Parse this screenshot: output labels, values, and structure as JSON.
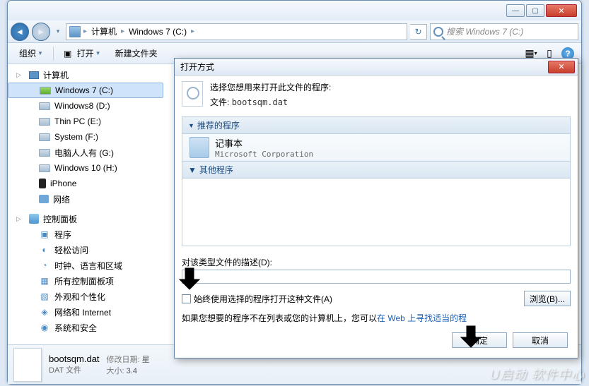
{
  "window": {
    "min_icon": "—",
    "max_icon": "▢",
    "close_icon": "✕"
  },
  "nav": {
    "back_icon": "◄",
    "fwd_icon": "►",
    "history_icon": "▾",
    "bc_root": "计算机",
    "bc_drive": "Windows 7  (C:)",
    "bc_sep": "▸",
    "refresh_icon": "↻",
    "search_placeholder": "搜索 Windows 7  (C:)"
  },
  "toolbar": {
    "organize": "组织",
    "open": "打开",
    "newfolder": "新建文件夹",
    "view_icon": "▦",
    "help_icon": "?"
  },
  "sidebar": {
    "computer": "计算机",
    "drives": [
      {
        "label": "Windows 7  (C:)",
        "selected": true,
        "cls": "win"
      },
      {
        "label": "Windows8 (D:)",
        "cls": ""
      },
      {
        "label": "Thin PC (E:)",
        "cls": ""
      },
      {
        "label": "System (F:)",
        "cls": ""
      },
      {
        "label": "电脑人人有  (G:)",
        "cls": ""
      },
      {
        "label": "Windows 10 (H:)",
        "cls": ""
      }
    ],
    "iphone": "iPhone",
    "network": "网络",
    "control_panel": "控制面板",
    "cp_items": [
      "程序",
      "轻松访问",
      "时钟、语言和区域",
      "所有控制面板项",
      "外观和个性化",
      "网络和 Internet",
      "系统和安全"
    ]
  },
  "details": {
    "filename": "bootsqm.dat",
    "filetype": "DAT 文件",
    "modlabel": "修改日期:",
    "modval": "星",
    "sizelabel": "大小:",
    "sizeval": "3.4"
  },
  "dialog": {
    "title": "打开方式",
    "close_icon": "✕",
    "prompt": "选择您想用来打开此文件的程序:",
    "file_label": "文件:",
    "file_name": "bootsqm.dat",
    "recommended": "推荐的程序",
    "program_name": "记事本",
    "program_vendor": "Microsoft Corporation",
    "other_programs": "其他程序",
    "desc_label": "对该类型文件的描述(D):",
    "desc_value": "",
    "always_label": "始终使用选择的程序打开这种文件(A)",
    "browse_btn": "浏览(B)...",
    "hint_prefix": "如果您想要的程序不在列表或您的计算机上，您可以",
    "hint_link": "在 Web 上寻找适当的程",
    "ok_btn": "确定",
    "cancel_btn": "取消"
  },
  "watermark": "U启动 软件中心"
}
